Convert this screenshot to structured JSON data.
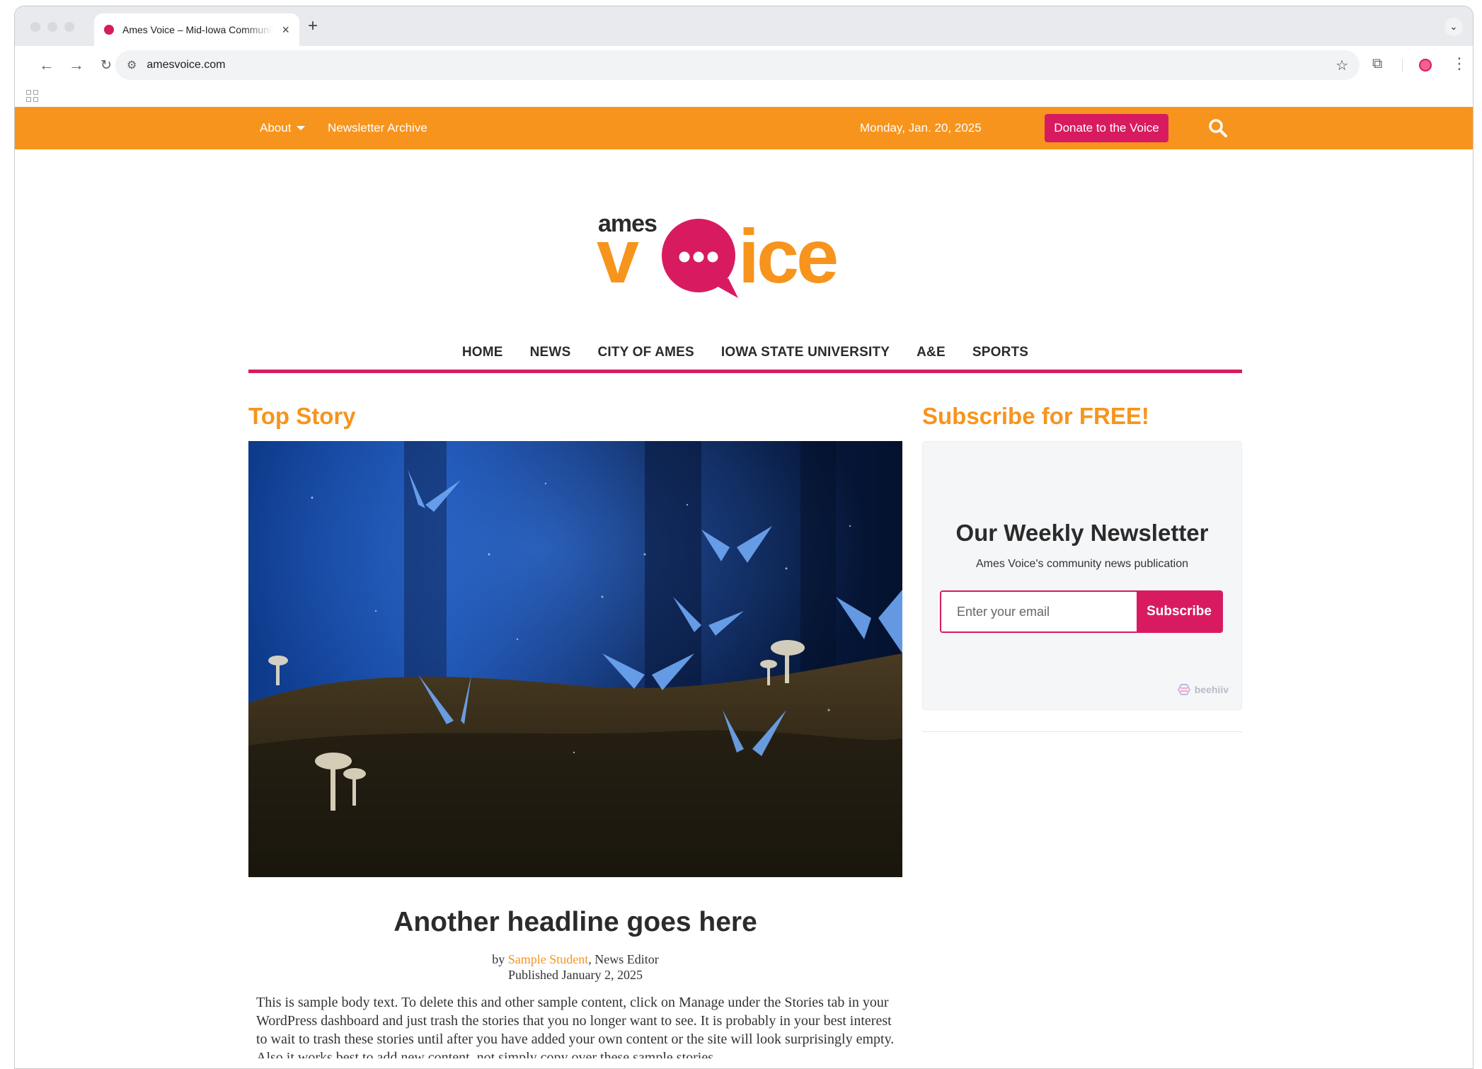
{
  "browser": {
    "tab_title": "Ames Voice – Mid-Iowa Community News",
    "new_tab": "+",
    "close": "×",
    "url": "amesvoice.com"
  },
  "topbar": {
    "about": "About",
    "newsletter_archive": "Newsletter Archive",
    "date": "Monday, Jan. 20, 2025",
    "donate": "Donate to the Voice",
    "bg_color": "#f7941d",
    "accent_color": "#d81b60"
  },
  "logo": {
    "small_text": "ames",
    "big_text_1": "v",
    "big_text_2": "ice"
  },
  "main_nav": [
    "HOME",
    "NEWS",
    "CITY OF AMES",
    "IOWA STATE UNIVERSITY",
    "A&E",
    "SPORTS"
  ],
  "top_story": {
    "section_title": "Top Story",
    "headline": "Another headline goes here",
    "by": "by",
    "author": "Sample Student",
    "role": ", News Editor",
    "published": "Published January 2, 2025",
    "body": "This is sample body text.  To delete this and other sample content, click on Manage under the Stories tab in your WordPress dashboard and just trash the stories that you no longer want to see. It is probably in your best interest to wait to trash these stories until after you have added your own content or the site will look surprisingly empty. Also it works best to add new content, not simply copy over these sample stories."
  },
  "subscribe": {
    "section_title": "Subscribe for FREE!",
    "title": "Our Weekly Newsletter",
    "description": "Ames Voice's community news publication",
    "email_placeholder": "Enter your email",
    "button": "Subscribe",
    "powered_by": "beehiiv"
  }
}
